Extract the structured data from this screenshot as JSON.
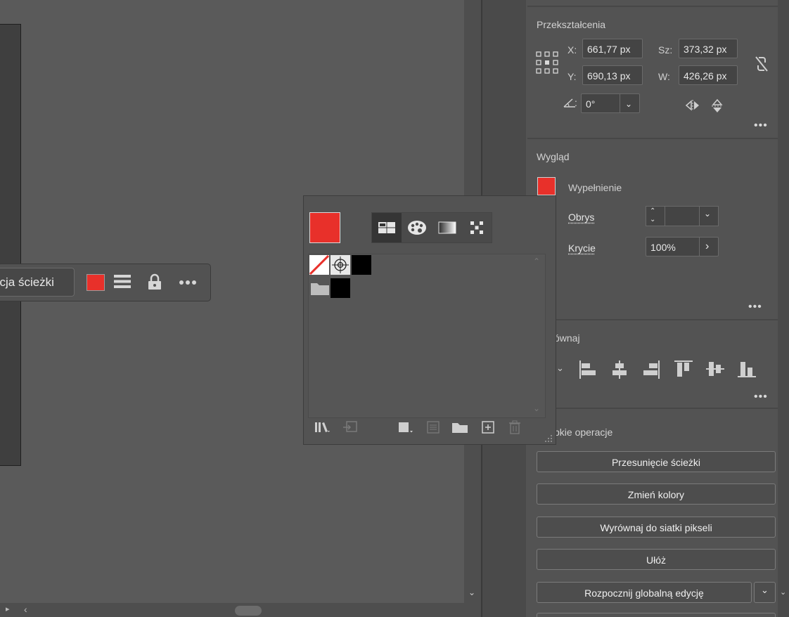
{
  "taskbar": {
    "path_label": "ycja ścieżki",
    "fill_color": "#e8302a"
  },
  "swatches_panel": {
    "current_color": "#e8302a"
  },
  "properties": {
    "transform": {
      "title": "Przekształcenia",
      "x_label": "X:",
      "x_value": "661,77 px",
      "y_label": "Y:",
      "y_value": "690,13 px",
      "w_label": "Sz:",
      "w_value": "373,32 px",
      "h_label": "W:",
      "h_value": "426,26 px",
      "angle_value": "0°"
    },
    "appearance": {
      "title": "Wygląd",
      "fill_label": "Wypełnienie",
      "fill_color": "#e8302a",
      "stroke_label": "Obrys",
      "opacity_label": "Krycie",
      "opacity_value": "100%"
    },
    "align": {
      "title": "ównaj"
    },
    "quick_actions": {
      "title": "bkie operacje",
      "buttons": [
        "Przesunięcie ścieżki",
        "Zmień kolory",
        "Wyrównaj do siatki pikseli",
        "Ułóż",
        "Rozpocznij globalną edycję"
      ]
    }
  }
}
